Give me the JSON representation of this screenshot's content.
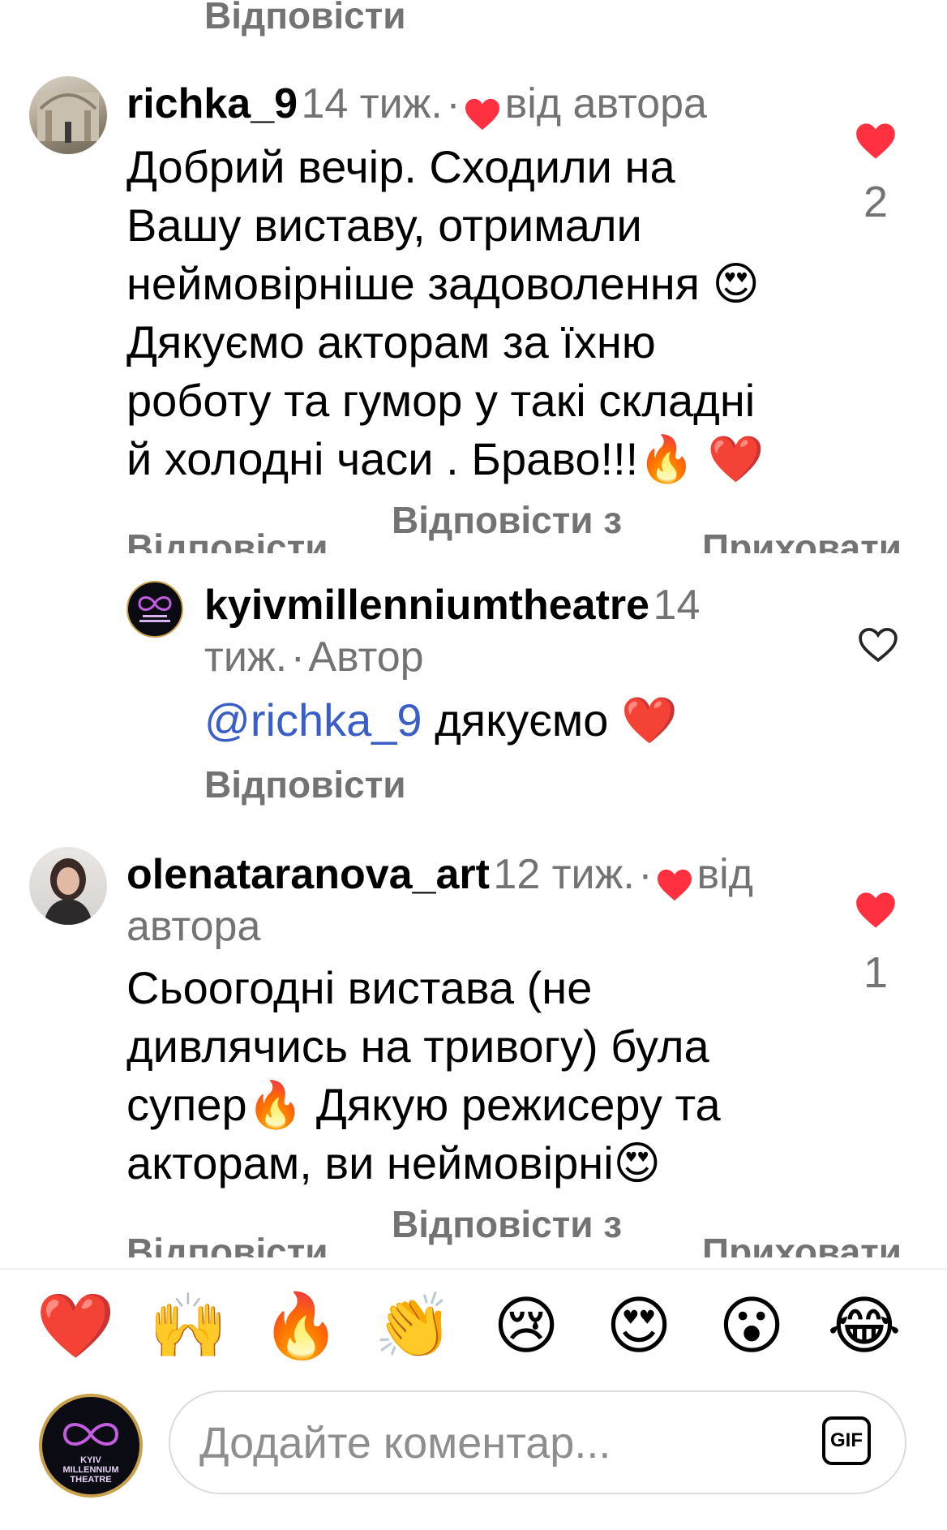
{
  "top_reply": {
    "label": "Відповісти"
  },
  "comments": [
    {
      "username": "richka_9",
      "time": "14 тиж.",
      "liked_by_author": "від автора",
      "text_lines": [
        "Добрий вечір. Сходили на",
        "Вашу виставу, отримали",
        "неймовірніше задоволення 😍",
        "Дякуємо акторам за їхню",
        "роботу та гумор у такі складні",
        "й холодні часи . Браво!!!🔥 ❤️"
      ],
      "likes": "2",
      "actions": {
        "reply": "Відповісти",
        "reply_with": "Відповісти з",
        "hide": "Приховати"
      }
    },
    {
      "username": "olenataranova_art",
      "time": "12 тиж.",
      "liked_by_author_1": "від",
      "liked_by_author_2": "автора",
      "text_lines": [
        "Сьоогодні вистава (не",
        "дивлячись на тривогу) була",
        "супер🔥 Дякую режисеру та",
        "акторам, ви неймовірні😍"
      ],
      "likes": "1",
      "actions": {
        "reply": "Відповісти",
        "reply_with": "Відповісти з",
        "hide": "Приховати"
      }
    }
  ],
  "author_reply": {
    "username": "kyivmillenniumtheatre",
    "time_part1": "14",
    "time_part2": "тиж.",
    "author_label": "Автор",
    "mention": "@richka_9",
    "text": " дякуємо ❤️",
    "reply": "Відповісти"
  },
  "reactions": [
    "❤️",
    "🙌",
    "🔥",
    "👏",
    "😢",
    "😍",
    "😮",
    "😂"
  ],
  "composer": {
    "placeholder": "Додайте коментар...",
    "gif_label": "GIF",
    "avatar_text_1": "KYIV",
    "avatar_text_2": "MILLENNIUM",
    "avatar_text_3": "THEATRE"
  },
  "colors": {
    "heart_red": "#ff3040",
    "muted": "#737373",
    "mention": "#3a5ec8"
  }
}
